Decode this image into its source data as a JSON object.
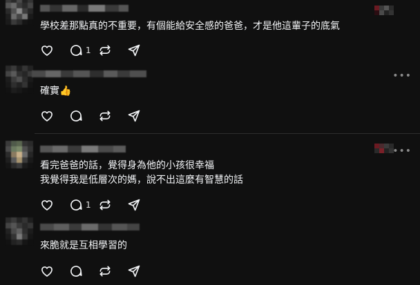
{
  "comments": [
    {
      "text": "學校差那點真的不重要，有個能給安全感的爸爸，才是他這輩子的底氣",
      "like_count": "",
      "reply_count": "1",
      "icons": [
        "heart-icon",
        "comment-icon",
        "repost-icon",
        "share-icon"
      ]
    },
    {
      "text": "確實👍",
      "reply_count": ""
    },
    {
      "text_lines": [
        "看完爸爸的話，覺得身為他的小孩很幸福",
        "我覺得我是低層次的媽，說不出這麼有智慧的話"
      ],
      "reply_count": "1"
    },
    {
      "text": "來脆就是互相學習的",
      "reply_count": ""
    }
  ],
  "more_label": "•••",
  "colors": {
    "background": "#101010",
    "text": "#f3f5f7",
    "icon": "#f3f5f7",
    "muted": "#8a8a8a",
    "divider": "#2d2d2d"
  }
}
